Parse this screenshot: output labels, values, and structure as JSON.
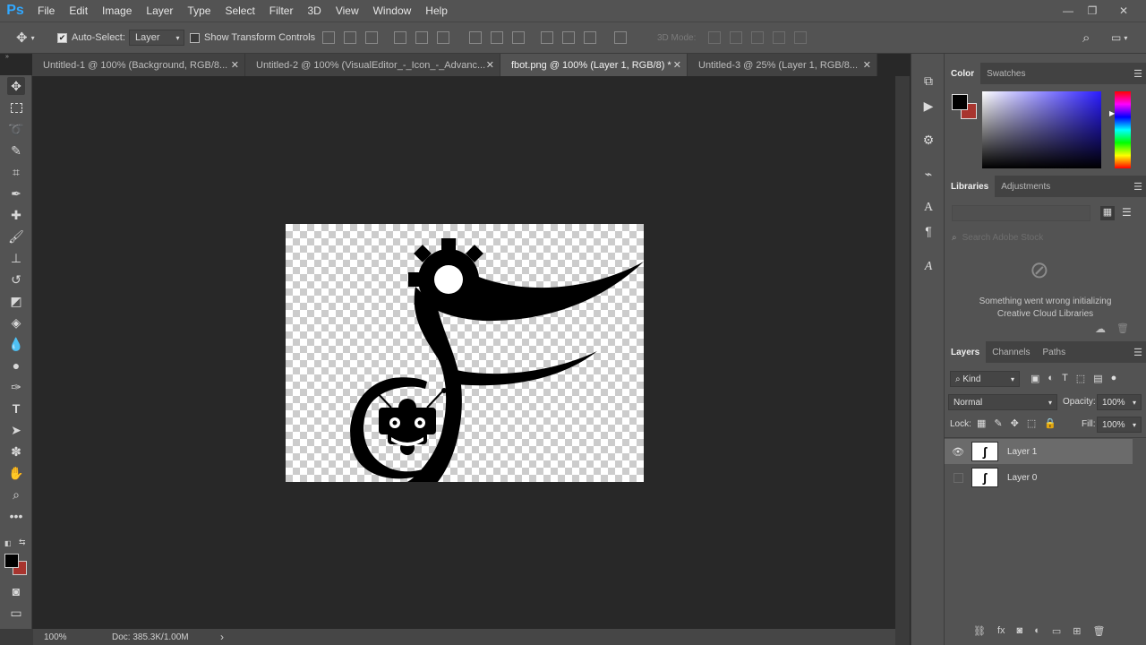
{
  "app": {
    "logo": "Ps"
  },
  "menu": [
    "File",
    "Edit",
    "Image",
    "Layer",
    "Type",
    "Select",
    "Filter",
    "3D",
    "View",
    "Window",
    "Help"
  ],
  "window_controls": {
    "minimize": "—",
    "restore": "❐",
    "close": "✕"
  },
  "options_bar": {
    "auto_select_label": "Auto-Select:",
    "auto_select_target": "Layer",
    "show_transform_label": "Show Transform Controls",
    "mode_3d_label": "3D Mode:"
  },
  "tabs": [
    {
      "label": "Untitled-1 @ 100% (Background, RGB/8...",
      "close": "✕",
      "active": false
    },
    {
      "label": "Untitled-2 @ 100% (VisualEditor_-_Icon_-_Advanc...",
      "close": "✕",
      "active": false
    },
    {
      "label": "fbot.png @ 100% (Layer 1, RGB/8) *",
      "close": "✕",
      "active": true
    },
    {
      "label": "Untitled-3 @ 25% (Layer 1, RGB/8...",
      "close": "✕",
      "active": false
    }
  ],
  "status": {
    "zoom": "100%",
    "doc_size": "Doc: 385.3K/1.00M",
    "arrow": "›"
  },
  "color_panel": {
    "tabs": [
      "Color",
      "Swatches"
    ],
    "foreground": "#000000",
    "background": "#a8352f",
    "field_hue": "#2a1cff"
  },
  "libraries_panel": {
    "tabs": [
      "Libraries",
      "Adjustments"
    ],
    "search_placeholder": "Search Adobe Stock",
    "error_line1": "Something went wrong initializing",
    "error_line2": "Creative Cloud Libraries"
  },
  "layers_panel": {
    "tabs": [
      "Layers",
      "Channels",
      "Paths"
    ],
    "kind_label": "Kind",
    "blend_mode": "Normal",
    "opacity_label": "Opacity:",
    "opacity_value": "100%",
    "lock_label": "Lock:",
    "fill_label": "Fill:",
    "fill_value": "100%",
    "layers": [
      {
        "name": "Layer 1",
        "visible": true,
        "selected": true
      },
      {
        "name": "Layer 0",
        "visible": false,
        "selected": false
      }
    ]
  }
}
